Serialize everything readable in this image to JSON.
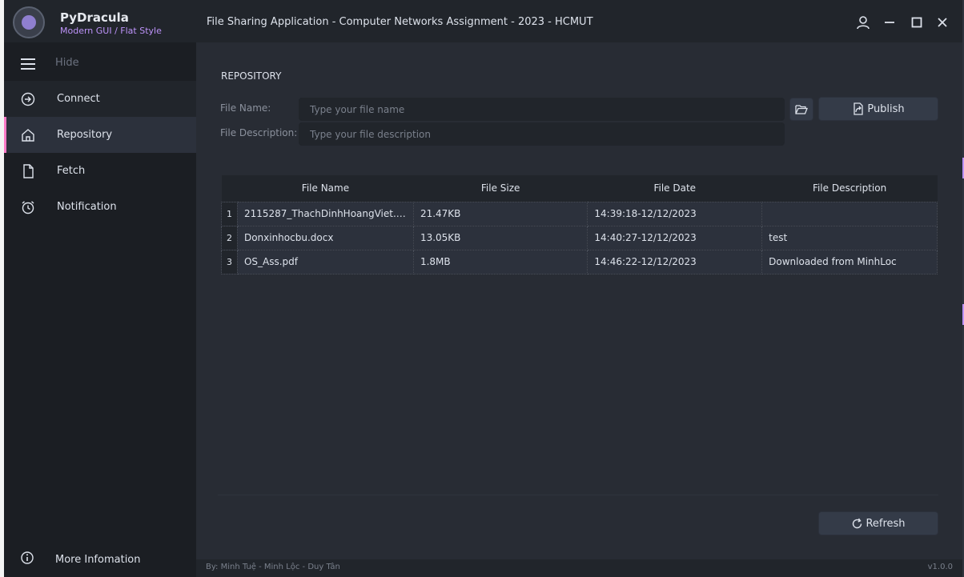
{
  "app": {
    "name": "PyDracula",
    "subtitle": "Modern GUI / Flat Style",
    "window_title": "File Sharing Application - Computer Networks Assignment - 2023 - HCMUT"
  },
  "sidebar": {
    "toggle_label": "Hide",
    "items": [
      {
        "label": "Connect",
        "icon": "arrow-circle-icon"
      },
      {
        "label": "Repository",
        "icon": "home-icon"
      },
      {
        "label": "Fetch",
        "icon": "file-icon"
      },
      {
        "label": "Notification",
        "icon": "clock-icon"
      }
    ],
    "active_item": "Repository",
    "bottom_item": {
      "label": "More Infomation",
      "icon": "info-icon"
    }
  },
  "repository": {
    "section_title": "REPOSITORY",
    "file_name_label": "File Name:",
    "file_name_placeholder": "Type your file name",
    "file_desc_label": "File Description:",
    "file_desc_placeholder": "Type your file description",
    "publish_label": "Publish",
    "refresh_label": "Refresh"
  },
  "table": {
    "columns": [
      "File Name",
      "File Size",
      "File Date",
      "File Description"
    ],
    "rows": [
      {
        "num": "1",
        "name": "2115287_ThachDinhHoangViet.d...",
        "size": "21.47KB",
        "date": "14:39:18-12/12/2023",
        "desc": ""
      },
      {
        "num": "2",
        "name": "Donxinhocbu.docx",
        "size": "13.05KB",
        "date": "14:40:27-12/12/2023",
        "desc": "test"
      },
      {
        "num": "3",
        "name": "OS_Ass.pdf",
        "size": "1.8MB",
        "date": "14:46:22-12/12/2023",
        "desc": "Downloaded from MinhLoc"
      }
    ]
  },
  "footer": {
    "credits": "By: Minh Tuệ - Minh Lộc - Duy Tân",
    "version": "v1.0.0"
  },
  "colors": {
    "background": "#282c34",
    "sidebar": "#1b1e23",
    "accent_pink": "#ff79c6",
    "accent_purple": "#bd93f9"
  }
}
